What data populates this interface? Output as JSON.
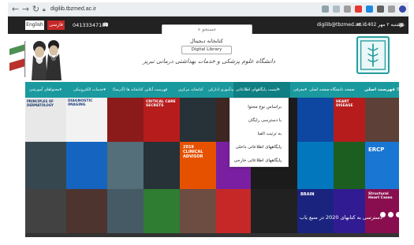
{
  "browser": {
    "back_icon": "arrow-left-icon",
    "forward_icon": "arrow-right-icon",
    "reload_icon": "reload-icon",
    "url": "digilib.tbzmed.ac.ir"
  },
  "topbar": {
    "date": "دوشنبه ۲ مهر 1402",
    "email": "digilib@tbzmed.ac.ir",
    "phone": "04133347189",
    "lang_fa": "فارسی",
    "lang_en": "English"
  },
  "search": {
    "placeholder": "جستجو"
  },
  "header": {
    "library_name_fa": "کتابخانه دیجیتال",
    "library_name_en": "Digital Library",
    "university_script": "دانشگاه علوم پزشکی و خدمات بهداشتی درمانی تبریز"
  },
  "nav": {
    "home": "فهرست اصلی",
    "items": [
      "صفحه دانشگاه",
      "صفحه اصلی",
      "معرفی▾",
      "لیست پایگاههای اطلاعاتی▾",
      "خودآموزی ادارکی",
      "کتابخانه مرکزی",
      "فهرست آنلاین کتابخانه ها (آذرسا)",
      "خدمات الکترونیکی▾",
      "محتوا‌های آموزشی▾"
    ]
  },
  "dropdown": {
    "items": [
      "براساس نوع محتوا",
      "با دسترسی رایگان",
      "به ترتیب الفبا",
      "پایگاههای اطلاعاتی داخلی",
      "پایگاههای اطلاعاتی خارجی"
    ]
  },
  "banner": {
    "caption": "دسترسی به کتابهای 2020 در منبع یاب",
    "slide_count": 4,
    "book_titles": [
      "PRINCIPLES OF DERMATOLOGY",
      "DIAGNOSTIC IMAGING",
      "CRITICAL CARE SECRETS",
      "2019 CLINICAL ADVISOR",
      "HEART DISEASE",
      "ERCP",
      "Structural Heart Cases",
      "BRAIN"
    ]
  },
  "colors": {
    "nav": "#1a9a9e",
    "topbar": "#222222",
    "banner": "#1b1b1b"
  }
}
